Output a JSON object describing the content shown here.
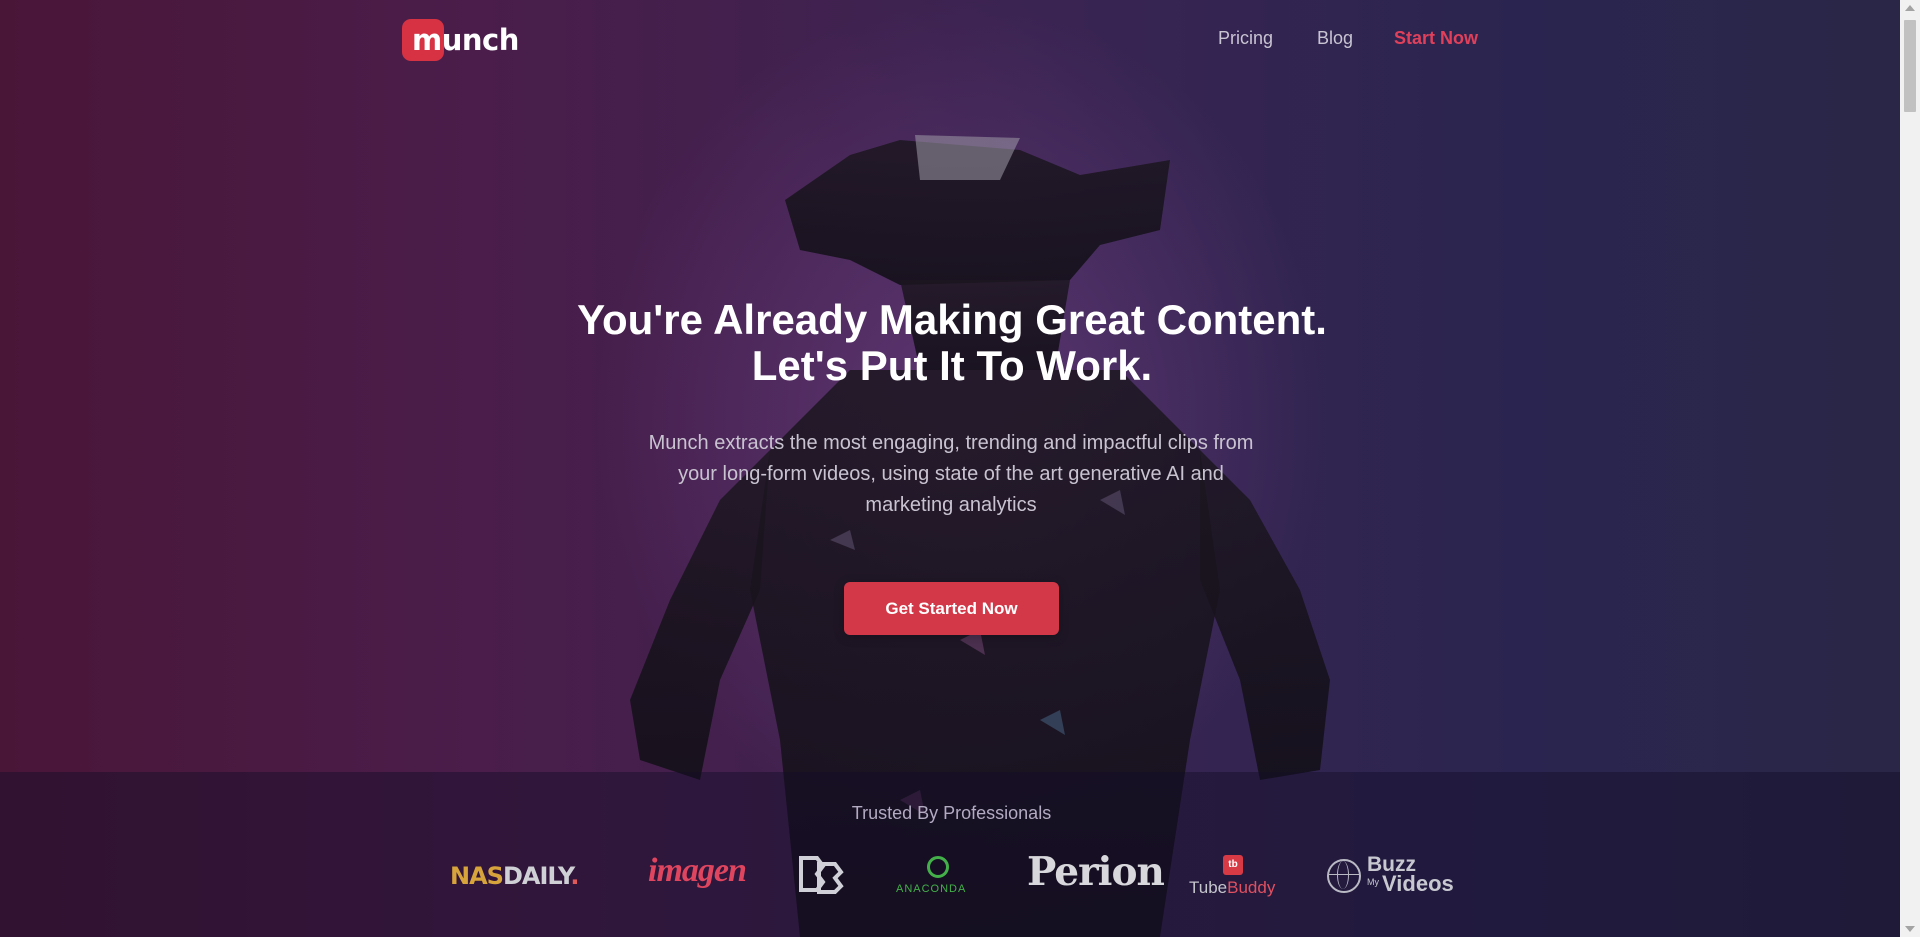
{
  "brand": {
    "logo_text": "munch",
    "accent_color": "#d63243"
  },
  "nav": {
    "pricing": "Pricing",
    "blog": "Blog",
    "start": "Start Now"
  },
  "hero": {
    "headline_line1": "You're Already Making Great Content.",
    "headline_line2": "Let's Put It To Work.",
    "subtext_line1": "Munch extracts the most engaging, trending and impactful clips from",
    "subtext_line2": "your long-form videos, using state of the art generative AI and",
    "subtext_line3": "marketing analytics",
    "cta_label": "Get Started Now"
  },
  "trusted": {
    "title": "Trusted By Professionals",
    "logos": {
      "nasdaily_1": "NAS",
      "nasdaily_2": "DAILY",
      "nasdaily_3": ".",
      "imagen": "imagen",
      "anaconda": "ANACONDA",
      "perion": "Perion",
      "tubebuddy_badge": "tb",
      "tubebuddy_1": "Tube",
      "tubebuddy_2": "Buddy",
      "buzz_1": "Buzz",
      "buzz_2": "My",
      "buzz_3": "Videos"
    }
  }
}
